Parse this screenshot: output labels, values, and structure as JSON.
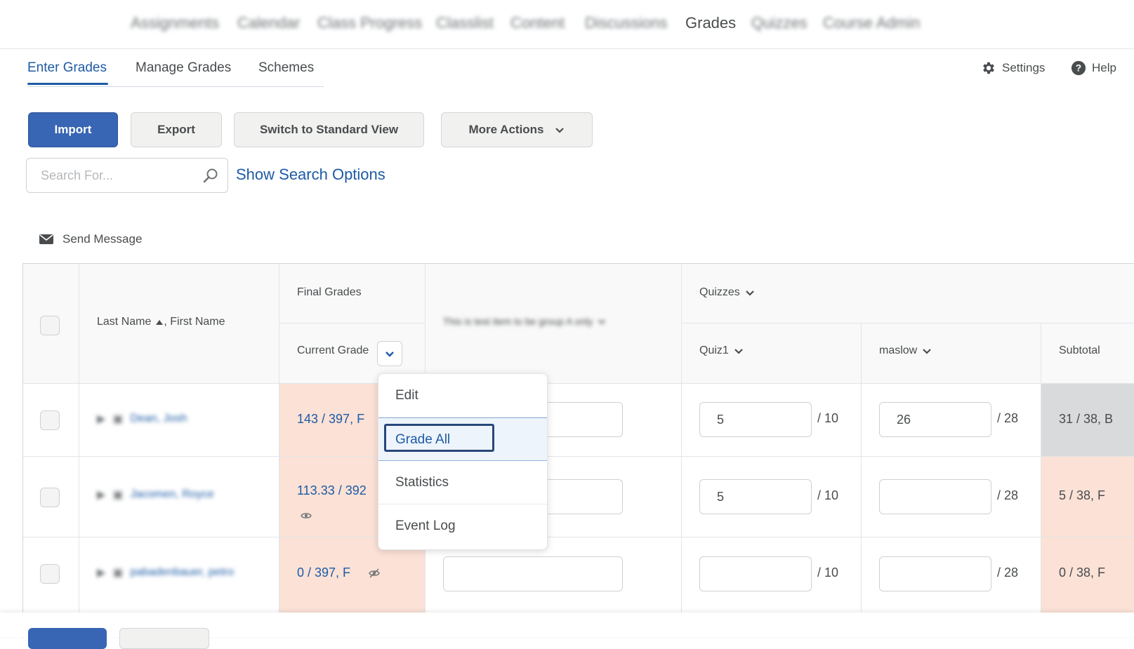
{
  "nav": {
    "items": [
      "Assignments",
      "Calendar",
      "Class Progress",
      "Classlist",
      "Content",
      "Discussions",
      "Grades",
      "Quizzes",
      "Course Admin"
    ]
  },
  "tabs": [
    "Enter Grades",
    "Manage Grades",
    "Schemes"
  ],
  "top_links": {
    "settings": "Settings",
    "help": "Help"
  },
  "toolbar": {
    "import": "Import",
    "export": "Export",
    "switch_view": "Switch to Standard View",
    "more_actions": "More Actions"
  },
  "search": {
    "placeholder": "Search For...",
    "options_link": "Show Search Options"
  },
  "send_message": "Send Message",
  "grid": {
    "headers": {
      "name": "Last Name",
      "name_tail": ", First Name",
      "final_grades": "Final Grades",
      "current_grade": "Current Grade",
      "hidden_item": "This is test item to be group A only",
      "quizzes": "Quizzes",
      "quiz1": "Quiz1",
      "maslow": "maslow",
      "subtotal": "Subtotal"
    },
    "rows": [
      {
        "name": "Dean, Josh",
        "current_grade": "143 / 397, F",
        "quiz1": "5",
        "quiz1_out": "/ 10",
        "maslow": "26",
        "maslow_out": "/ 28",
        "subtotal": "31 / 38, B"
      },
      {
        "name": "Jacomen, Royce",
        "current_grade": "113.33 / 392",
        "quiz1": "5",
        "quiz1_out": "/ 10",
        "maslow": "",
        "maslow_out": "/ 28",
        "subtotal": "5 / 38, F"
      },
      {
        "name": "pabadenbauer, petro",
        "current_grade": "0 / 397, F",
        "quiz1": "",
        "quiz1_out": "/ 10",
        "maslow": "",
        "maslow_out": "/ 28",
        "subtotal": "0 / 38, F"
      }
    ]
  },
  "menu": {
    "items": [
      "Edit",
      "Grade All",
      "Statistics",
      "Event Log"
    ]
  }
}
